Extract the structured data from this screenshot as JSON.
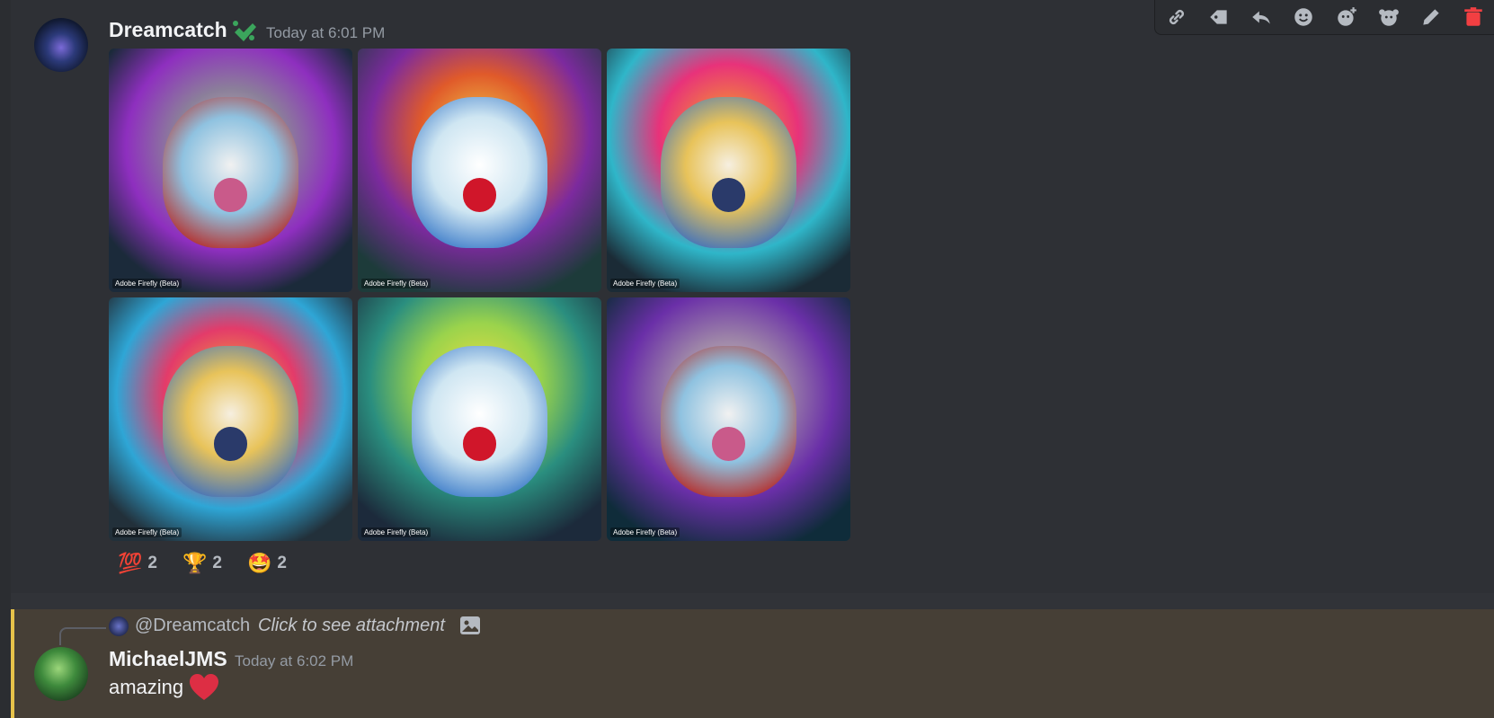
{
  "message1": {
    "username": "Dreamcatch",
    "timestamp": "Today at 6:01 PM",
    "images": [
      {
        "watermark": "Adobe Firefly (Beta)"
      },
      {
        "watermark": "Adobe Firefly (Beta)"
      },
      {
        "watermark": "Adobe Firefly (Beta)"
      },
      {
        "watermark": "Adobe Firefly (Beta)"
      },
      {
        "watermark": "Adobe Firefly (Beta)"
      },
      {
        "watermark": "Adobe Firefly (Beta)"
      }
    ],
    "reactions": [
      {
        "emoji": "💯",
        "count": "2"
      },
      {
        "emoji": "🏆",
        "count": "2"
      },
      {
        "emoji": "🤩",
        "count": "2"
      }
    ]
  },
  "toolbar": {
    "icons": [
      "link-icon",
      "tag-icon",
      "reply-icon",
      "emoji-icon",
      "add-reaction-icon",
      "super-reaction-icon",
      "edit-icon",
      "delete-icon"
    ]
  },
  "message2": {
    "reply_user": "@Dreamcatch",
    "reply_text": "Click to see attachment",
    "username": "MichaelJMS",
    "timestamp": "Today at 6:02 PM",
    "content": "amazing"
  },
  "colors": {
    "background": "#313338",
    "highlight": "#463f36",
    "mention_bar": "#e6c24a",
    "delete": "#f23f42"
  }
}
